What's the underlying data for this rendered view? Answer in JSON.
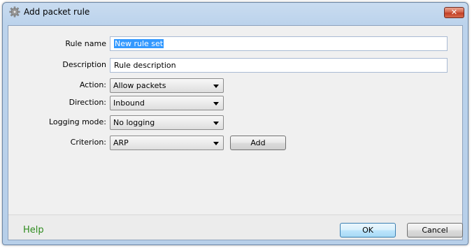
{
  "window": {
    "title": "Add packet rule",
    "close_label": "✕"
  },
  "form": {
    "rule_name": {
      "label": "Rule name",
      "value": "New rule set"
    },
    "description": {
      "label": "Description",
      "value": "Rule description"
    },
    "action": {
      "label": "Action:",
      "selected": "Allow packets"
    },
    "direction": {
      "label": "Direction:",
      "selected": "Inbound"
    },
    "logging_mode": {
      "label": "Logging mode:",
      "selected": "No logging"
    },
    "criterion": {
      "label": "Criterion:",
      "selected": "ARP",
      "add_label": "Add"
    }
  },
  "footer": {
    "help_label": "Help",
    "ok_label": "OK",
    "cancel_label": "Cancel"
  },
  "colors": {
    "help_link": "#2e8b1e",
    "selection": "#3399ff",
    "title_gradient": "#c9dcf0",
    "close_button": "#c23f26"
  },
  "icons": {
    "window": "gear-icon",
    "close": "close-icon",
    "dropdown": "chevron-down-icon"
  }
}
